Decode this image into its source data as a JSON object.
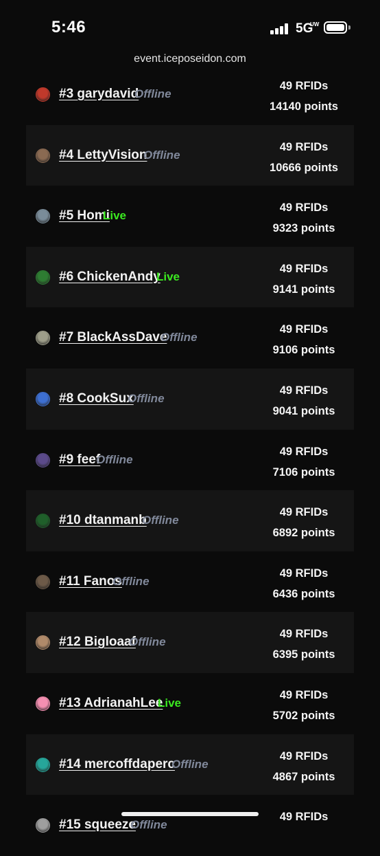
{
  "status_bar": {
    "time": "5:46",
    "network": "5G",
    "network_sub": "UW"
  },
  "browser": {
    "url": "event.iceposeidon.com"
  },
  "leaderboard": [
    {
      "label": "#3 garydavid",
      "status": "Offline",
      "rfids": "49 RFIDs",
      "points": "14140 points",
      "avatar_color": "#c0392b"
    },
    {
      "label": "#4 LettyVision",
      "status": "Offline",
      "rfids": "49 RFIDs",
      "points": "10666 points",
      "avatar_color": "#8a6a52"
    },
    {
      "label": "#5 Homi",
      "status": "Live",
      "rfids": "49 RFIDs",
      "points": "9323 points",
      "avatar_color": "#7a8c99"
    },
    {
      "label": "#6 ChickenAndy",
      "status": "Live",
      "rfids": "49 RFIDs",
      "points": "9141 points",
      "avatar_color": "#2e7d32"
    },
    {
      "label": "#7 BlackAssDave",
      "status": "Offline",
      "rfids": "49 RFIDs",
      "points": "9106 points",
      "avatar_color": "#9e9e8a"
    },
    {
      "label": "#8 CookSux",
      "status": "Offline",
      "rfids": "49 RFIDs",
      "points": "9041 points",
      "avatar_color": "#3d6fd1"
    },
    {
      "label": "#9 feef",
      "status": "Offline",
      "rfids": "49 RFIDs",
      "points": "7106 points",
      "avatar_color": "#5b4a8a"
    },
    {
      "label": "#10 dtanmanb",
      "status": "Offline",
      "rfids": "49 RFIDs",
      "points": "6892 points",
      "avatar_color": "#1f5f2a"
    },
    {
      "label": "#11 Fanos",
      "status": "Offline",
      "rfids": "49 RFIDs",
      "points": "6436 points",
      "avatar_color": "#6d5a48"
    },
    {
      "label": "#12 Bigloaaf",
      "status": "Offline",
      "rfids": "49 RFIDs",
      "points": "6395 points",
      "avatar_color": "#b08a6a"
    },
    {
      "label": "#13 AdrianahLee",
      "status": "Live",
      "rfids": "49 RFIDs",
      "points": "5702 points",
      "avatar_color": "#f48fb1"
    },
    {
      "label": "#14 mercoffdaperc",
      "status": "Offline",
      "rfids": "49 RFIDs",
      "points": "4867 points",
      "avatar_color": "#26a69a"
    },
    {
      "label": "#15 squeeze",
      "status": "Offline",
      "rfids": "49 RFIDs",
      "points": "",
      "avatar_color": "#9e9e9e"
    }
  ]
}
